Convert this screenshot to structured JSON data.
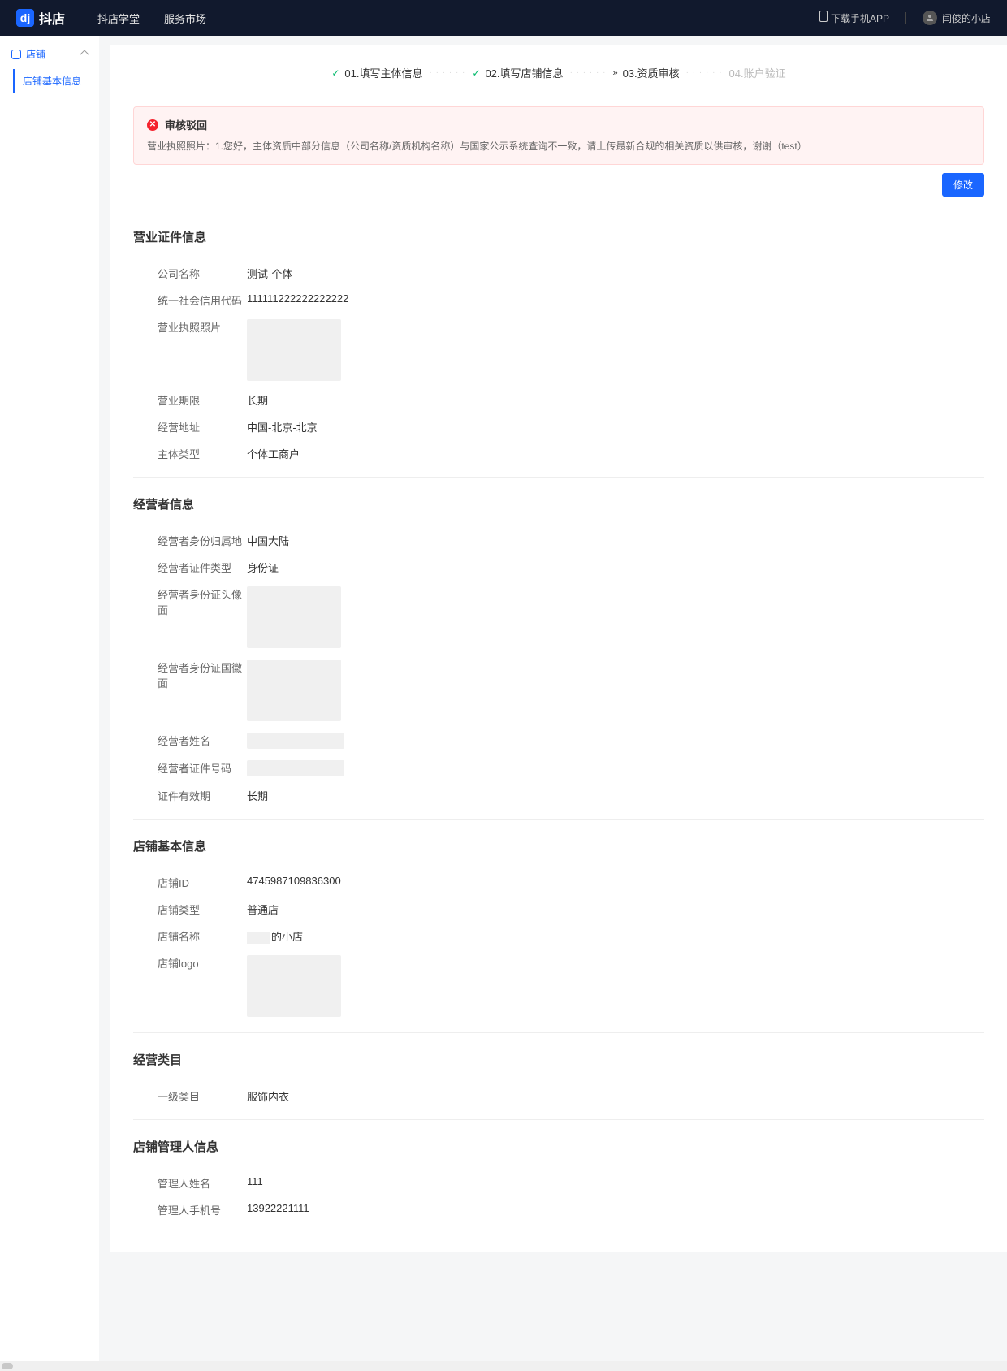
{
  "header": {
    "logo": "抖店",
    "nav": [
      "抖店学堂",
      "服务市场"
    ],
    "download": "下载手机APP",
    "username": "闫俊的小店"
  },
  "sidebar": {
    "group": "店铺",
    "active": "店铺基本信息"
  },
  "steps": [
    {
      "num": "01",
      "label": "填写主体信息",
      "state": "done"
    },
    {
      "num": "02",
      "label": "填写店铺信息",
      "state": "done"
    },
    {
      "num": "03",
      "label": "资质审核",
      "state": "active"
    },
    {
      "num": "04",
      "label": "账户验证",
      "state": "wait"
    }
  ],
  "alert": {
    "title": "审核驳回",
    "body": "营业执照照片：1.您好，主体资质中部分信息（公司名称/资质机构名称）与国家公示系统查询不一致，请上传最新合规的相关资质以供审核，谢谢（test）"
  },
  "modifyBtn": "修改",
  "sections": {
    "license": {
      "title": "营业证件信息",
      "rows": {
        "company": {
          "label": "公司名称",
          "value": "测试-个体"
        },
        "uscc": {
          "label": "统一社会信用代码",
          "value": "111111222222222222"
        },
        "photo": {
          "label": "营业执照照片"
        },
        "period": {
          "label": "营业期限",
          "value": "长期"
        },
        "address": {
          "label": "经营地址",
          "value": "中国-北京-北京"
        },
        "subjectType": {
          "label": "主体类型",
          "value": "个体工商户"
        }
      }
    },
    "operator": {
      "title": "经营者信息",
      "rows": {
        "region": {
          "label": "经营者身份归属地",
          "value": "中国大陆"
        },
        "idType": {
          "label": "经营者证件类型",
          "value": "身份证"
        },
        "idFront": {
          "label": "经营者身份证头像面"
        },
        "idBack": {
          "label": "经营者身份证国徽面"
        },
        "name": {
          "label": "经营者姓名"
        },
        "idNum": {
          "label": "经营者证件号码"
        },
        "validity": {
          "label": "证件有效期",
          "value": "长期"
        }
      }
    },
    "shop": {
      "title": "店铺基本信息",
      "rows": {
        "id": {
          "label": "店铺ID",
          "value": "4745987109836300"
        },
        "type": {
          "label": "店铺类型",
          "value": "普通店"
        },
        "name": {
          "label": "店铺名称",
          "suffix": "的小店"
        },
        "logo": {
          "label": "店铺logo"
        }
      }
    },
    "category": {
      "title": "经营类目",
      "rows": {
        "cat1": {
          "label": "一级类目",
          "value": "服饰内衣"
        }
      }
    },
    "manager": {
      "title": "店铺管理人信息",
      "rows": {
        "name": {
          "label": "管理人姓名",
          "value": "111"
        },
        "phone": {
          "label": "管理人手机号",
          "value": "13922221111"
        }
      }
    }
  }
}
